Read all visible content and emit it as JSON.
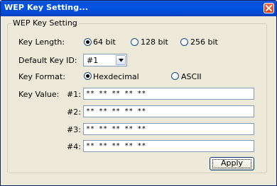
{
  "window": {
    "title": "WEP Key Setting...",
    "close_icon": "close-x-icon"
  },
  "group": {
    "legend": "WEP Key Setting"
  },
  "key_length": {
    "label": "Key Length:",
    "options": [
      "64 bit",
      "128 bit",
      "256 bit"
    ],
    "selected": "64 bit"
  },
  "default_key_id": {
    "label": "Default Key ID:",
    "value": "#1",
    "arrow_icon": "chevron-down-icon"
  },
  "key_format": {
    "label": "Key Format:",
    "options": [
      "Hexdecimal",
      "ASCII"
    ],
    "selected": "Hexdecimal"
  },
  "key_value": {
    "label": "Key Value:",
    "keys": [
      {
        "label": "#1:",
        "value": "** ** ** ** **"
      },
      {
        "label": "#2:",
        "value": "** ** ** ** **"
      },
      {
        "label": "#3:",
        "value": "** ** ** ** **"
      },
      {
        "label": "#4:",
        "value": "** ** ** ** **"
      }
    ]
  },
  "apply_label": "Apply",
  "colors": {
    "titlebar": "#0055e5",
    "dialog_bg": "#ece9d8",
    "input_border": "#7f9db9"
  }
}
